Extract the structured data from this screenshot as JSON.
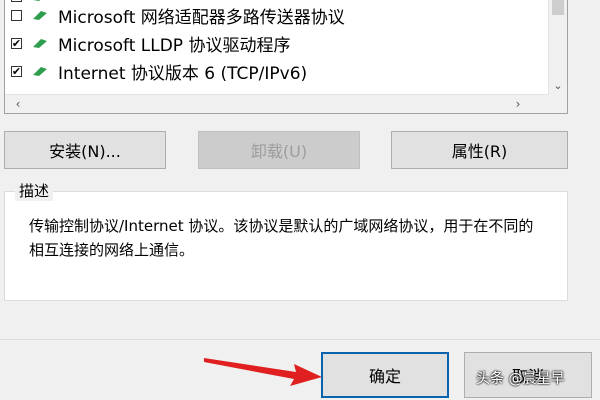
{
  "protocol_list": {
    "items": [
      {
        "label": "Microsoft 网络适配器多路传送器协议",
        "checked": false
      },
      {
        "label": "Microsoft LLDP 协议驱动程序",
        "checked": true
      },
      {
        "label": "Internet 协议版本 6 (TCP/IPv6)",
        "checked": true
      }
    ]
  },
  "buttons": {
    "install": "安装(N)...",
    "uninstall": "卸载(U)",
    "properties": "属性(R)"
  },
  "description": {
    "title": "描述",
    "text": "传输控制协议/Internet 协议。该协议是默认的广域网络协议，用于在不同的相互连接的网络上通信。"
  },
  "dialog": {
    "ok": "确定",
    "cancel": "取消"
  },
  "watermark": "头条 @晨星早",
  "colors": {
    "accent_border": "#0a64ad",
    "arrow": "#e02020",
    "icon_green": "#2e9e4e"
  }
}
